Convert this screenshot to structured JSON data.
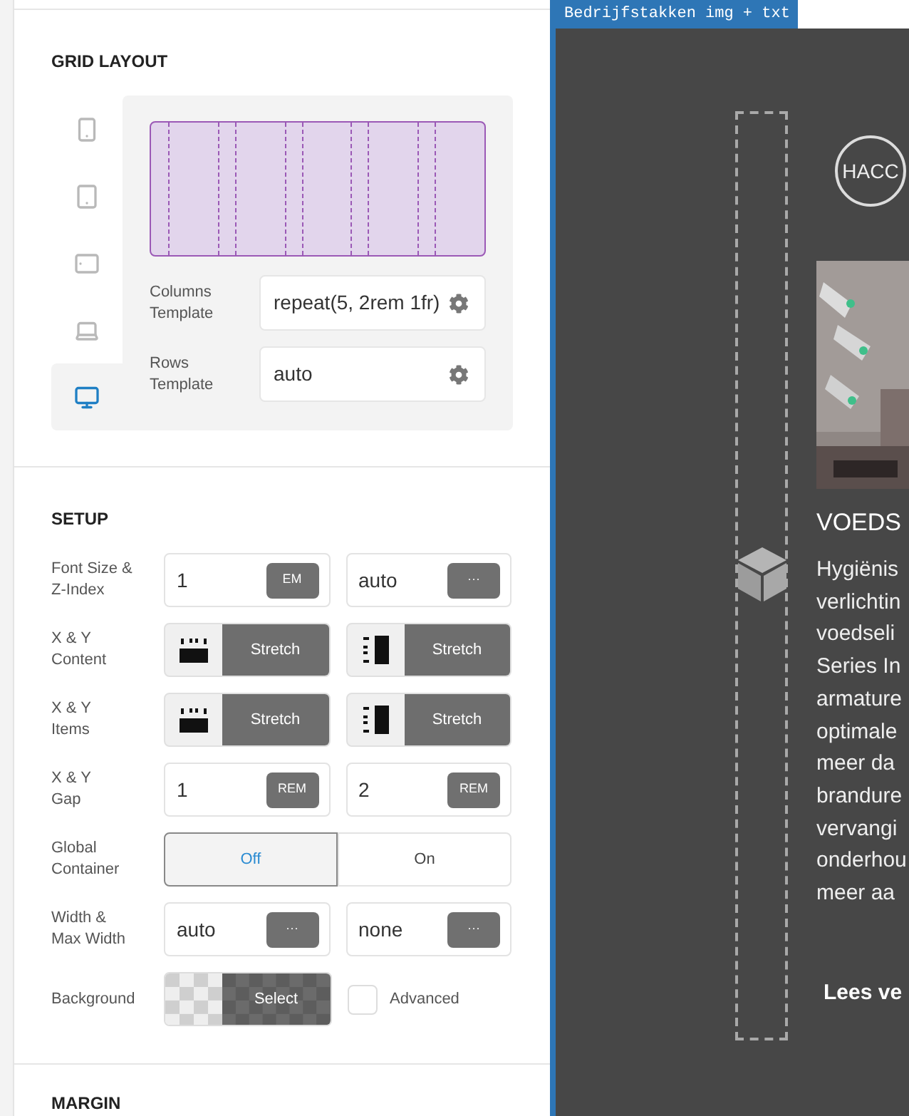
{
  "editor_panel": {
    "grid_layout": {
      "title": "GRID LAYOUT",
      "devices": [
        {
          "kind": "phone",
          "selected": false
        },
        {
          "kind": "tablet",
          "selected": false
        },
        {
          "kind": "tablet-landscape",
          "selected": false
        },
        {
          "kind": "laptop",
          "selected": false
        },
        {
          "kind": "desktop",
          "selected": true
        }
      ],
      "fields": [
        {
          "label_lines": [
            "Columns",
            "Template"
          ],
          "value": "repeat(5, 2rem 1fr)"
        },
        {
          "label_lines": [
            "Rows",
            "Template"
          ],
          "value": "auto"
        }
      ]
    },
    "setup": {
      "title": "SETUP",
      "rows": [
        {
          "kind": "inputs",
          "label_lines": [
            "Font Size &",
            "Z-Index"
          ],
          "controls": [
            {
              "value": "1",
              "unit": "EM"
            },
            {
              "value": "auto",
              "unit": "···"
            }
          ]
        },
        {
          "kind": "align",
          "label_lines": [
            "X & Y",
            "Content"
          ],
          "controls": [
            {
              "kind": "columns",
              "value": "Stretch"
            },
            {
              "kind": "rows",
              "value": "Stretch"
            }
          ]
        },
        {
          "kind": "align",
          "label_lines": [
            "X & Y",
            "Items"
          ],
          "controls": [
            {
              "kind": "columns",
              "value": "Stretch"
            },
            {
              "kind": "rows",
              "value": "Stretch"
            }
          ]
        },
        {
          "kind": "inputs",
          "label_lines": [
            "X & Y",
            "Gap"
          ],
          "controls": [
            {
              "value": "1",
              "unit": "REM"
            },
            {
              "value": "2",
              "unit": "REM"
            }
          ]
        },
        {
          "kind": "toggle",
          "label_lines": [
            "Global",
            "Container"
          ],
          "options": [
            {
              "label": "Off",
              "selected": true
            },
            {
              "label": "On",
              "selected": false
            }
          ]
        },
        {
          "kind": "inputs",
          "label_lines": [
            "Width &",
            "Max Width"
          ],
          "controls": [
            {
              "value": "auto",
              "unit": "···"
            },
            {
              "value": "none",
              "unit": "···"
            }
          ]
        },
        {
          "kind": "background",
          "label_lines": [
            "Background"
          ],
          "button": "Select",
          "checkbox": {
            "label": "Advanced",
            "checked": false
          }
        }
      ]
    },
    "next_section": "MARGIN"
  },
  "canvas": {
    "tab": "Bedrijfstakken img + txt",
    "logo_text": "HACC",
    "heading": "VOEDS",
    "paragraph_lines": [
      "Hygiënis",
      "verlichtin",
      "voedseli",
      "Series In",
      "armature",
      "optimale",
      "meer da",
      "brandure",
      "vervangi",
      "onderhou",
      "meer aa"
    ],
    "link": "Lees ve"
  }
}
